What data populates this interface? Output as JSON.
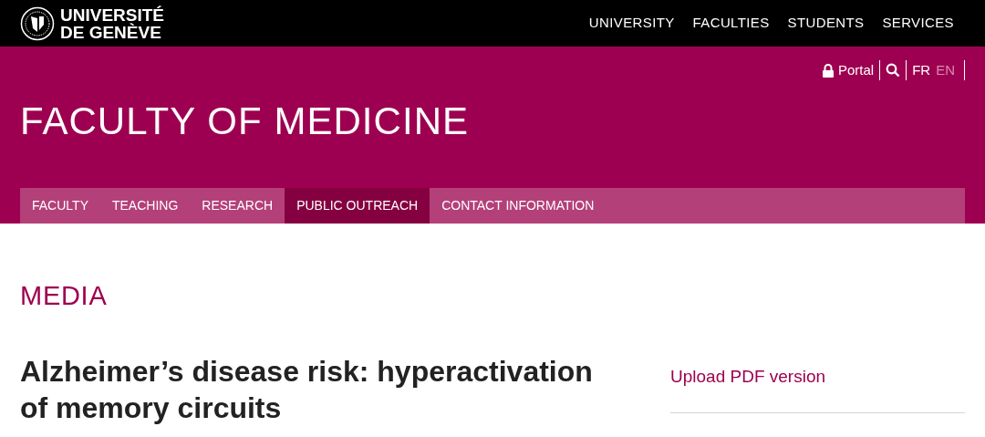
{
  "logo": {
    "line_1": "UNIVERSITÉ",
    "line_2": "DE GENÈVE"
  },
  "top_nav": [
    "UNIVERSITY",
    "FACULTIES",
    "STUDENTS",
    "SERVICES"
  ],
  "utility": {
    "portal": "Portal",
    "languages": [
      {
        "label": "FR",
        "selected": false
      },
      {
        "label": "EN",
        "selected": true
      }
    ]
  },
  "site_title": "FACULTY OF MEDICINE",
  "main_nav": [
    {
      "label": "FACULTY",
      "selected": false
    },
    {
      "label": "TEACHING",
      "selected": false
    },
    {
      "label": "RESEARCH",
      "selected": false
    },
    {
      "label": "PUBLIC OUTREACH",
      "selected": true
    },
    {
      "label": "CONTACT INFORMATION",
      "selected": false
    }
  ],
  "section_title": "MEDIA",
  "article_title": "Alzheimer’s disease risk: hyperactivation of memory circuits",
  "sidebar_link": "Upload PDF version"
}
